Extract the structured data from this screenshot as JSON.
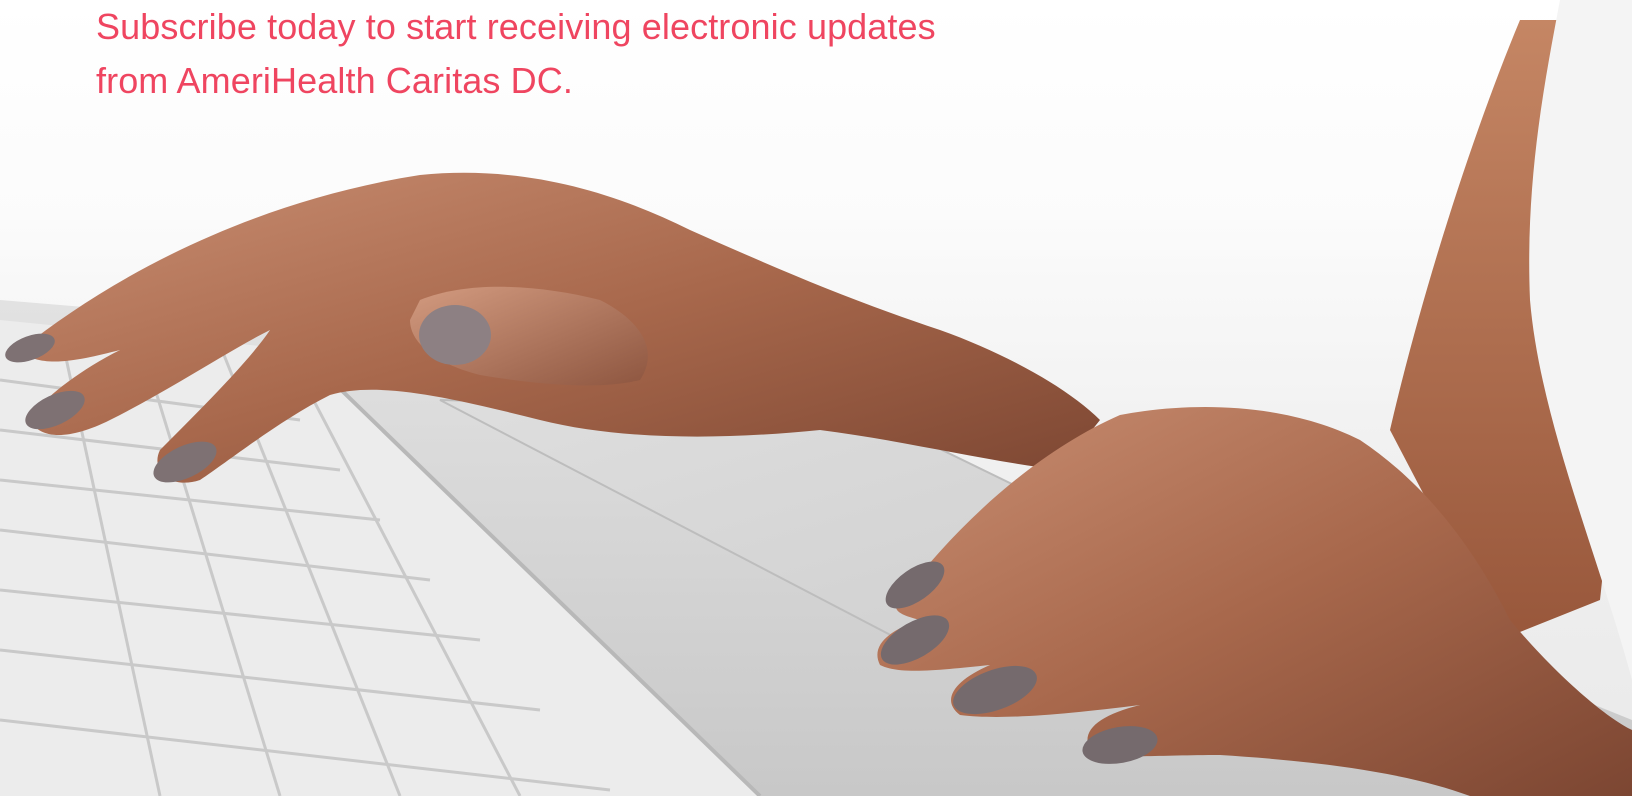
{
  "hero": {
    "headline_line1": "Subscribe today to start receiving electronic updates",
    "headline_line2": "from AmeriHealth Caritas DC.",
    "accent_color": "#ef4560"
  }
}
